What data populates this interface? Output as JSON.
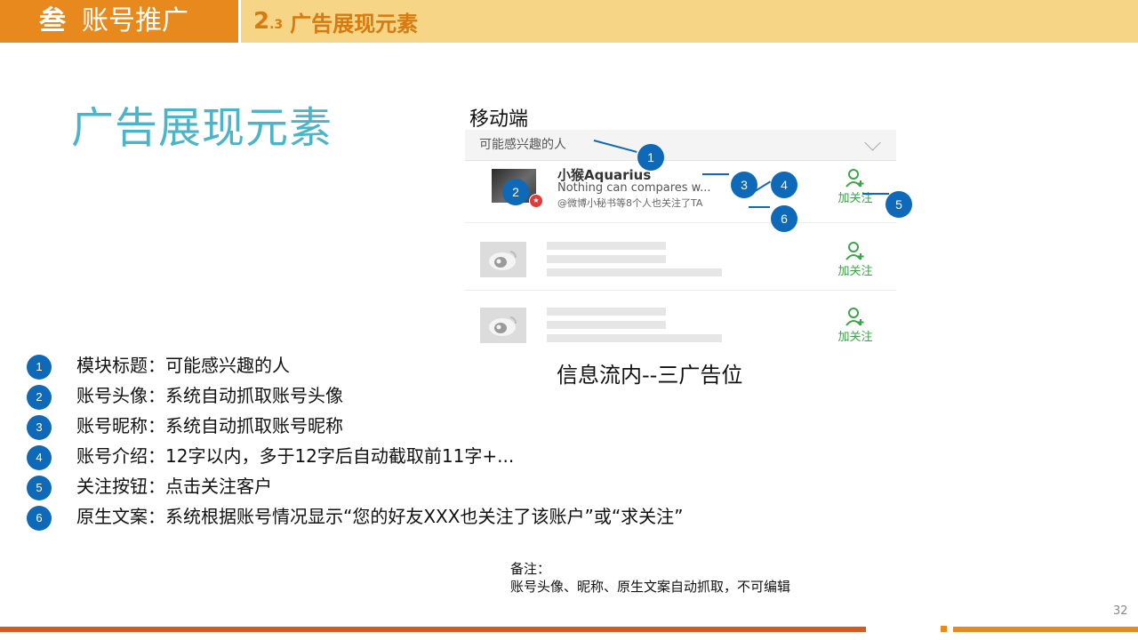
{
  "header": {
    "section_number": "叁",
    "section_title": "账号推广",
    "sub_number_main": "2",
    "sub_number_minor": ".3",
    "sub_title": "广告展现元素"
  },
  "page_title": "广告展现元素",
  "mobile_label": "移动端",
  "mock": {
    "module_title": "可能感兴趣的人",
    "nickname": "小猴Aquarius",
    "intro": "Nothing can compares w...",
    "origin_text": "@微博小秘书等8个人也关注了TA",
    "follow_label": "加关注"
  },
  "markers": [
    "1",
    "2",
    "3",
    "4",
    "5",
    "6"
  ],
  "caption": "信息流内--三广告位",
  "legend": [
    {
      "num": "1",
      "text": "模块标题：可能感兴趣的人"
    },
    {
      "num": "2",
      "text": "账号头像：系统自动抓取账号头像"
    },
    {
      "num": "3",
      "text": "账号昵称：系统自动抓取账号昵称"
    },
    {
      "num": "4",
      "text": "账号介绍：12字以内，多于12字后自动截取前11字+..."
    },
    {
      "num": "5",
      "text": "关注按钮：点击关注客户"
    },
    {
      "num": "6",
      "text": "原生文案：系统根据账号情况显示“您的好友XXX也关注了该账户”或“求关注”"
    }
  ],
  "note": {
    "label": "备注：",
    "text": "账号头像、昵称、原生文案自动抓取，不可编辑"
  },
  "page_number": "32",
  "colors": {
    "orange": "#e8891e",
    "light_orange": "#f6d587",
    "teal_title": "#4ab4c8",
    "marker_blue": "#0e6ab8",
    "follow_green": "#3aa547"
  }
}
